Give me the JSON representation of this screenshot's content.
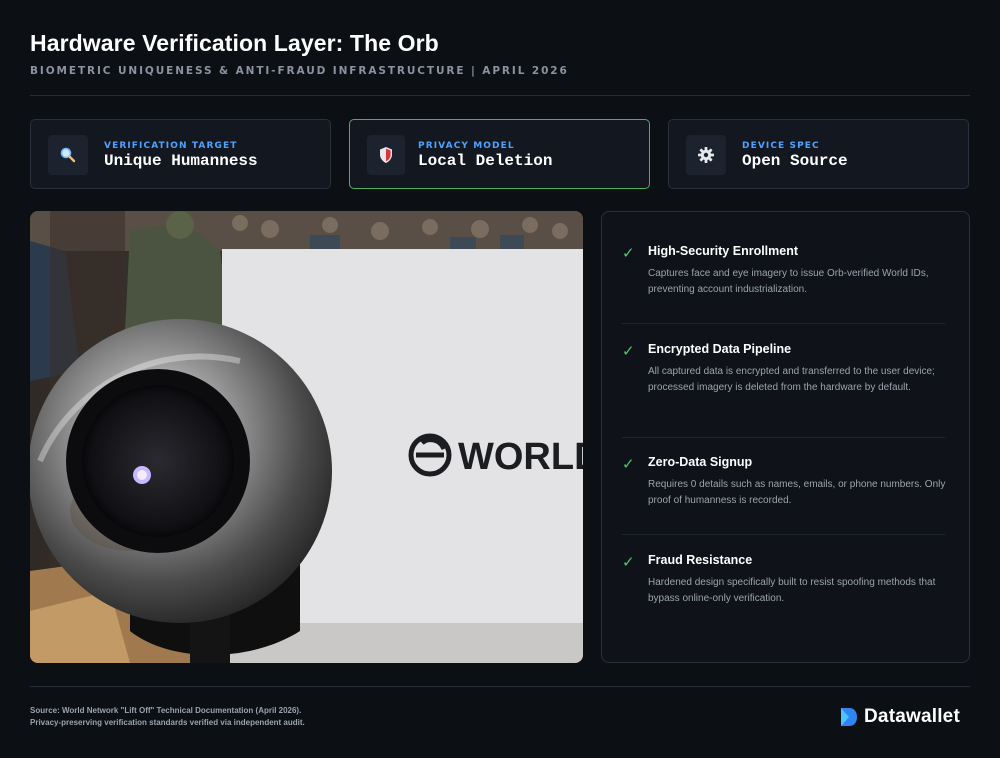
{
  "header": {
    "title": "Hardware Verification Layer: The Orb",
    "subtitle": "BIOMETRIC UNIQUENESS & ANTI-FRAUD INFRASTRUCTURE | APRIL 2026"
  },
  "cards": [
    {
      "icon": "search-icon",
      "label": "VERIFICATION TARGET",
      "value": "Unique Humanness",
      "accent": "#4fa3ff"
    },
    {
      "icon": "shield-icon",
      "label": "PRIVACY MODEL",
      "value": "Local Deletion",
      "accent": "#4fae5e"
    },
    {
      "icon": "gear-icon",
      "label": "DEVICE SPEC",
      "value": "Open Source",
      "accent": "#4fa3ff"
    }
  ],
  "photo": {
    "sign_text": "WORLD"
  },
  "features": [
    {
      "title": "High-Security Enrollment",
      "desc": "Captures face and eye imagery to issue Orb-verified World IDs, preventing account industrialization."
    },
    {
      "title": "Encrypted Data Pipeline",
      "desc": "All captured data is encrypted and transferred to the user device; processed imagery is deleted from the hardware by default."
    },
    {
      "title": "Zero-Data Signup",
      "desc": "Requires 0 details such as names, emails, or phone numbers. Only proof of humanness is recorded."
    },
    {
      "title": "Fraud Resistance",
      "desc": "Hardened design specifically built to resist spoofing methods that bypass online-only verification."
    }
  ],
  "check_glyph": "✓",
  "footer": {
    "source_line1": "Source: World Network \"Lift Off\" Technical Documentation (April 2026).",
    "source_line2": "Privacy-preserving verification standards verified via independent audit.",
    "brand": "Datawallet"
  },
  "colors": {
    "background": "#0c0f14",
    "accent_blue": "#4fa3ff",
    "accent_green": "#4fae5e",
    "check_green": "#4fc86a"
  }
}
